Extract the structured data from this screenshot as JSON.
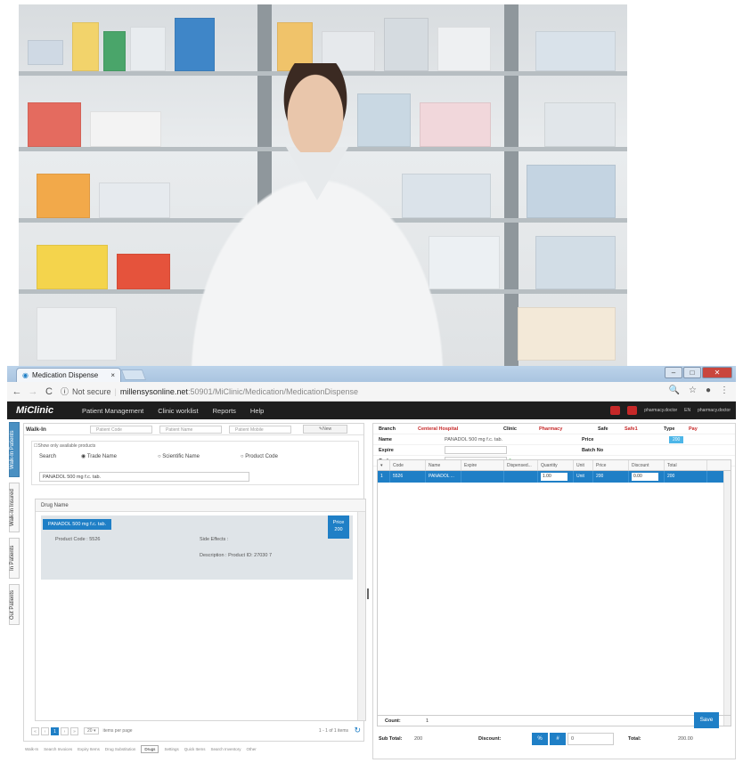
{
  "browser": {
    "tab_title": "Medication Dispense",
    "tab_close": "×",
    "not_secure": "Not secure",
    "url_host": "millensysonline.net",
    "url_path": ":50901/MiClinic/Medication/MedicationDispense"
  },
  "app": {
    "logo": "MiClinic",
    "nav": [
      "Patient Management",
      "Clinic worklist",
      "Reports",
      "Help"
    ],
    "user": "pharmacy.doctor",
    "lang": "EN",
    "role": "pharmacy.doctor"
  },
  "vtabs": [
    "Walk-In Patients",
    "Walk-In Insured",
    "In Patients",
    "Out Patients"
  ],
  "walkin": {
    "title": "Walk-In",
    "patient_code_ph": "Patient Code",
    "patient_name_ph": "Patient Name",
    "patient_mobile_ph": "Patient Mobile",
    "new_label": "New"
  },
  "search": {
    "show_available": "Show only available products",
    "label": "Search",
    "options": [
      "Trade Name",
      "Scientific Name",
      "Product Code"
    ],
    "query": "PANADOL 500 mg f.c. tab."
  },
  "results": {
    "header": "Drug Name",
    "drug_name": "PANADOL 500 mg f.c. tab.",
    "price_label": "Price",
    "price_value": "200",
    "product_code": "Product Code : 5526",
    "side_effects": "Side Effects :",
    "description": "Description : Product ID: 27030 7"
  },
  "pager": {
    "current": "1",
    "page_size": "20",
    "per_page": "items per page",
    "range": "1 - 1 of 1 items"
  },
  "bottom_tabs": [
    "Walk-In",
    "Search Invoices",
    "Expiry Items",
    "Drug Substitution",
    "Drugs",
    "Settings",
    "Quick Items",
    "Search Inventory",
    "Other"
  ],
  "dispense": {
    "branch_label": "Branch",
    "branch": "Centeral Hospital",
    "clinic_label": "Clinic",
    "clinic": "Pharmacy",
    "safe_label": "Safe",
    "safe": "Safe1",
    "type_label": "Type",
    "type_pill": "200",
    "pay": "Pay",
    "name_label": "Name",
    "name": "PANADOL 500 mg f.c. tab.",
    "price_label": "Price",
    "expire_label": "Expire",
    "batch_label": "Batch No",
    "code_label": "Code"
  },
  "grid": {
    "headers": [
      "Code",
      "Name",
      "Expire",
      "Dispensed...",
      "Quantity",
      "Unit",
      "Price",
      "Discount",
      "Total"
    ],
    "row": {
      "idx": "1",
      "code": "5526",
      "name": "PANADOL ...",
      "expire": "",
      "dispensed": "",
      "quantity": "1.00",
      "unit": "Unit",
      "price": "200",
      "discount": "0.00",
      "total": "200"
    },
    "count_label": "Count:",
    "count": "1"
  },
  "totals": {
    "subtotal_label": "Sub Total:",
    "subtotal": "200",
    "discount_label": "Discount:",
    "pct": "%",
    "hash": "#",
    "discount_value": "0",
    "total_label": "Total:",
    "total": "200.00",
    "save": "Save"
  }
}
